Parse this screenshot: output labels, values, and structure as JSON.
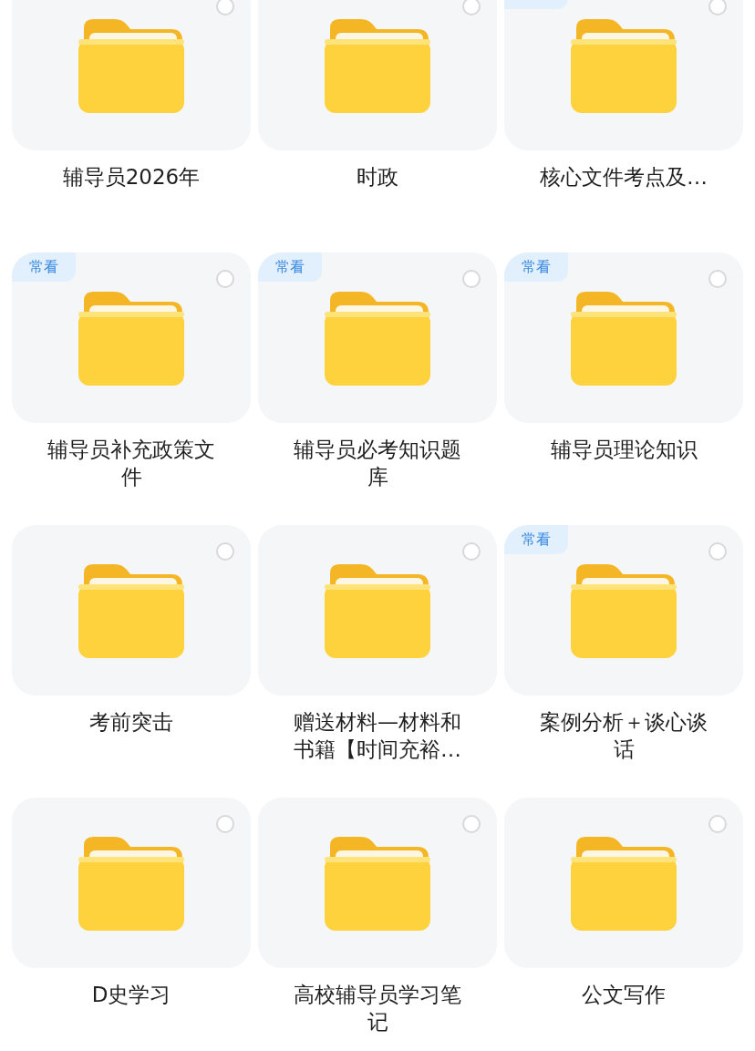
{
  "folders": [
    {
      "name": "辅导员2026年",
      "frequent": false,
      "selected": false
    },
    {
      "name": "时政",
      "frequent": false,
      "selected": false
    },
    {
      "name": "核心文件考点及…",
      "frequent": true,
      "selected": false
    },
    {
      "name": "辅导员补充政策文件",
      "frequent": true,
      "badge": "常看",
      "selected": false
    },
    {
      "name": "辅导员必考知识题库",
      "frequent": true,
      "badge": "常看",
      "selected": false
    },
    {
      "name": "辅导员理论知识",
      "frequent": true,
      "badge": "常看",
      "selected": false
    },
    {
      "name": "考前突击",
      "frequent": false,
      "selected": false
    },
    {
      "name": "赠送材料—材料和书籍【时间充裕…",
      "frequent": false,
      "selected": false
    },
    {
      "name": "案例分析＋谈心谈话",
      "frequent": true,
      "badge": "常看",
      "selected": false
    },
    {
      "name": "D史学习",
      "frequent": false,
      "selected": false
    },
    {
      "name": "高校辅导员学习笔记",
      "frequent": false,
      "selected": false
    },
    {
      "name": "公文写作",
      "frequent": false,
      "selected": false
    }
  ]
}
